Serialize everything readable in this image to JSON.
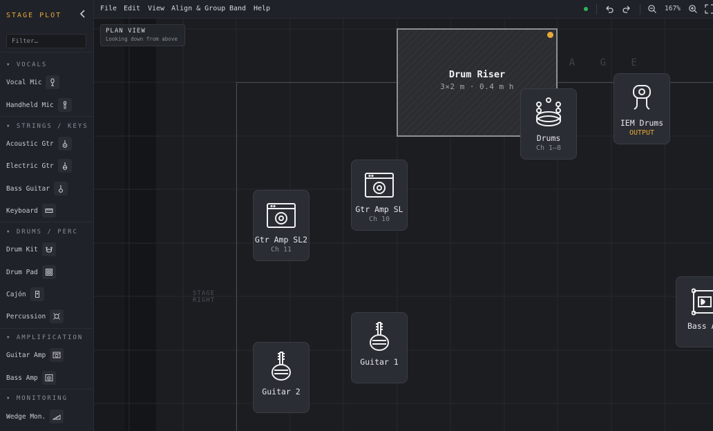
{
  "sidebar": {
    "title": "STAGE PLOT",
    "filter_placeholder": "Filter…",
    "categories": [
      {
        "label": "▾ VOCALS",
        "items": [
          {
            "label": "Vocal Mic",
            "icon": "mic-icon"
          },
          {
            "label": "Handheld Mic",
            "icon": "handheld-mic-icon"
          }
        ]
      },
      {
        "label": "▾ STRINGS / KEYS",
        "items": [
          {
            "label": "Acoustic Gtr",
            "icon": "acoustic-guitar-icon"
          },
          {
            "label": "Electric Gtr",
            "icon": "electric-guitar-icon"
          },
          {
            "label": "Bass Guitar",
            "icon": "bass-guitar-icon"
          },
          {
            "label": "Keyboard",
            "icon": "keyboard-icon"
          }
        ]
      },
      {
        "label": "▾ DRUMS / PERC",
        "items": [
          {
            "label": "Drum Kit",
            "icon": "drum-kit-icon"
          },
          {
            "label": "Drum Pad",
            "icon": "drum-pad-icon"
          },
          {
            "label": "Cajón",
            "icon": "cajon-icon"
          },
          {
            "label": "Percussion",
            "icon": "percussion-icon"
          }
        ]
      },
      {
        "label": "▾ AMPLIFICATION",
        "items": [
          {
            "label": "Guitar Amp",
            "icon": "guitar-amp-icon"
          },
          {
            "label": "Bass Amp",
            "icon": "bass-amp-icon"
          }
        ]
      },
      {
        "label": "▾ MONITORING",
        "items": [
          {
            "label": "Wedge Mon.",
            "icon": "wedge-monitor-icon"
          }
        ]
      }
    ]
  },
  "menubar": {
    "menus": [
      "File",
      "Edit",
      "View",
      "Align & Group",
      "Band",
      "Help"
    ],
    "status_color": "#2fb55a",
    "zoom": "167%"
  },
  "canvas": {
    "plan_view": {
      "title": "PLAN VIEW",
      "subtitle": "Looking down from above"
    },
    "stage_label": "S T A G E",
    "stage_right_label": "STAGE\nRIGHT",
    "riser": {
      "name": "Drum Riser",
      "dims": "3×2 m · 0.4 m h",
      "marker_color": "#e8a93a"
    },
    "nodes": [
      {
        "name": "Drums",
        "sub": "Ch 1–8",
        "icon": "drum-kit-icon"
      },
      {
        "name": "IEM Drums",
        "sub": "OUTPUT",
        "icon": "iem-icon"
      },
      {
        "name": "Gtr Amp SL",
        "sub": "Ch 10",
        "icon": "guitar-amp-icon"
      },
      {
        "name": "Gtr Amp SL2",
        "sub": "Ch 11",
        "icon": "guitar-amp-icon"
      },
      {
        "name": "Guitar 1",
        "sub": "",
        "icon": "electric-guitar-icon"
      },
      {
        "name": "Guitar 2",
        "sub": "",
        "icon": "electric-guitar-icon"
      },
      {
        "name": "Bass Amp",
        "sub": "",
        "icon": "bass-amp-icon"
      }
    ]
  }
}
